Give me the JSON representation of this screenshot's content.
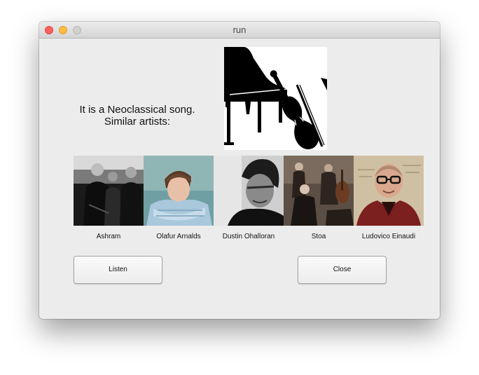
{
  "window": {
    "title": "run"
  },
  "message": {
    "line1": "It is a Neoclassical song.",
    "line2": "Similar artists:"
  },
  "genre_image": {
    "icon": "piano-and-violin-icon"
  },
  "artists": [
    {
      "name": "Ashram"
    },
    {
      "name": "Olafur Arnalds"
    },
    {
      "name": "Dustin Ohalloran"
    },
    {
      "name": "Stoa"
    },
    {
      "name": "Ludovico Einaudi"
    }
  ],
  "buttons": {
    "listen": "Listen",
    "close": "Close"
  }
}
